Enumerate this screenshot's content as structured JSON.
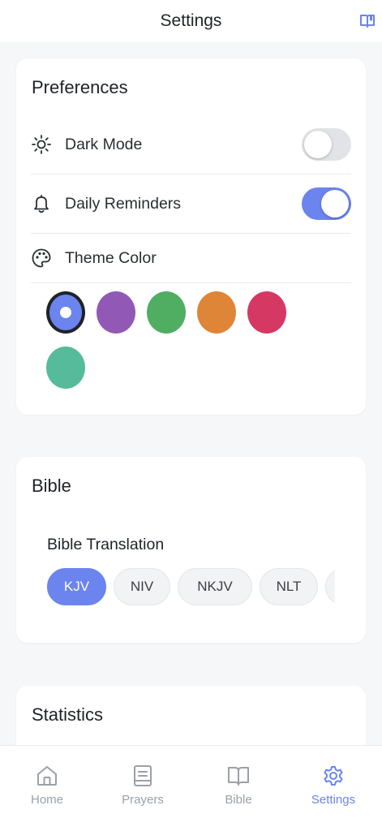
{
  "header": {
    "title": "Settings",
    "icon": "book-icon"
  },
  "preferences": {
    "title": "Preferences",
    "dark_mode": {
      "label": "Dark Mode",
      "icon": "sun-icon",
      "enabled": false
    },
    "daily_reminders": {
      "label": "Daily Reminders",
      "icon": "bell-icon",
      "enabled": true
    },
    "theme_color": {
      "label": "Theme Color",
      "icon": "palette-icon"
    },
    "colors": [
      "#6b84ee",
      "#9159b5",
      "#4fae62",
      "#de8538",
      "#d63864",
      "#55bb9b"
    ],
    "selected_color": "#6b84ee"
  },
  "bible": {
    "title": "Bible",
    "translation_label": "Bible Translation",
    "translations": [
      "KJV",
      "NIV",
      "NKJV",
      "NLT"
    ],
    "selected_translation": "KJV"
  },
  "statistics": {
    "title": "Statistics"
  },
  "tabs": [
    {
      "label": "Home",
      "icon": "home-icon"
    },
    {
      "label": "Prayers",
      "icon": "prayers-icon"
    },
    {
      "label": "Bible",
      "icon": "open-book-icon"
    },
    {
      "label": "Settings",
      "icon": "gear-icon"
    }
  ],
  "active_tab": "Settings",
  "accent_color": "#6b84ee"
}
